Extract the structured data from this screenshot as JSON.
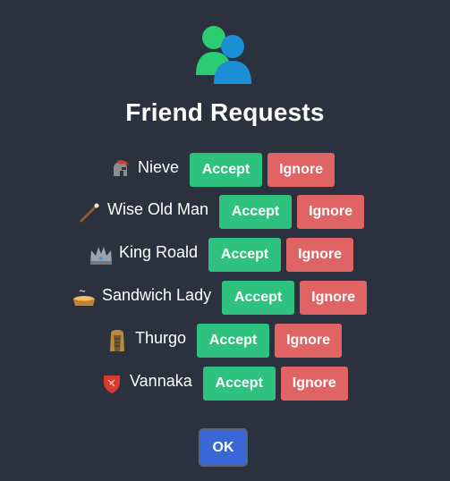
{
  "dialog": {
    "title": "Friend Requests",
    "header_icon": "two-users-icon",
    "ok_label": "OK"
  },
  "requests": [
    {
      "name": "Nieve",
      "icon": "spartan-helmet-icon",
      "accept_label": "Accept",
      "ignore_label": "Ignore"
    },
    {
      "name": "Wise Old Man",
      "icon": "magic-wand-icon",
      "accept_label": "Accept",
      "ignore_label": "Ignore"
    },
    {
      "name": "King Roald",
      "icon": "crown-icon",
      "accept_label": "Accept",
      "ignore_label": "Ignore"
    },
    {
      "name": "Sandwich Lady",
      "icon": "pie-icon",
      "accept_label": "Accept",
      "ignore_label": "Ignore"
    },
    {
      "name": "Thurgo",
      "icon": "dwarf-icon",
      "accept_label": "Accept",
      "ignore_label": "Ignore"
    },
    {
      "name": "Vannaka",
      "icon": "red-shield-icon",
      "accept_label": "Accept",
      "ignore_label": "Ignore"
    }
  ],
  "colors": {
    "background": "#2b313e",
    "accept": "#2ec27e",
    "ignore": "#e06464",
    "ok": "#3a67d6"
  }
}
